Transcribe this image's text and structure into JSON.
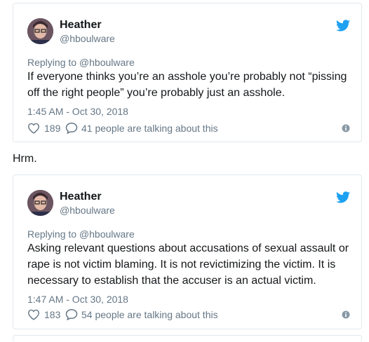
{
  "colors": {
    "twitter_blue": "#1da1f2",
    "text_primary": "#14171a",
    "text_secondary": "#657786",
    "border": "#e1e8ed"
  },
  "tweets": [
    {
      "author_name": "Heather",
      "author_handle": "@hboulware",
      "replying_to": "Replying to @hboulware",
      "text": "If everyone thinks you’re an asshole you’re probably not “pissing off the right people” you’re probably just an asshole.",
      "timestamp": "1:45 AM - Oct 30, 2018",
      "likes": "189",
      "talking": "41 people are talking about this",
      "icons": [
        "twitter-bird-icon",
        "heart-icon",
        "speech-bubble-icon",
        "info-icon"
      ]
    },
    {
      "author_name": "Heather",
      "author_handle": "@hboulware",
      "replying_to": "Replying to @hboulware",
      "text": "Asking relevant questions about accusations of sexual assault or rape is not victim blaming. It is not revictimizing the victim. It is necessary to establish that the accuser is an actual victim.",
      "timestamp": "1:47 AM - Oct 30, 2018",
      "likes": "183",
      "talking": "54 people are talking about this",
      "icons": [
        "twitter-bird-icon",
        "heart-icon",
        "speech-bubble-icon",
        "info-icon"
      ]
    }
  ],
  "between_text": "Hrm."
}
